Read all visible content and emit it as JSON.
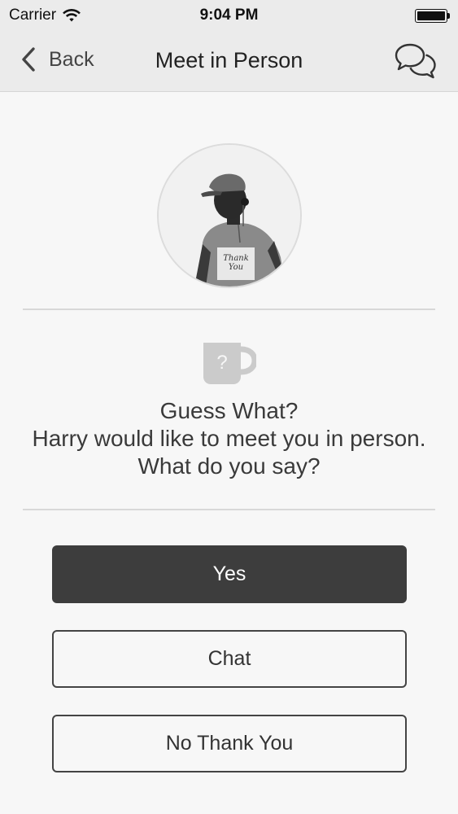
{
  "status_bar": {
    "carrier": "Carrier",
    "time": "9:04 PM",
    "wifi_icon": "wifi-icon",
    "battery_level": 1.0
  },
  "nav": {
    "back_label": "Back",
    "title": "Meet in Person",
    "back_icon": "chevron-left-icon",
    "chat_icon": "chat-bubbles-icon"
  },
  "profile": {
    "avatar_icon": "profile-photo"
  },
  "message": {
    "icon": "mystery-mug-icon",
    "icon_glyph": "?",
    "line1": "Guess What?",
    "line2": "Harry would like to meet you in person.",
    "line3": "What do you say?"
  },
  "actions": {
    "yes_label": "Yes",
    "chat_label": "Chat",
    "decline_label": "No Thank You"
  },
  "colors": {
    "primary_button": "#3d3d3d",
    "background": "#f7f7f7",
    "bar": "#ebebeb",
    "icon_gray": "#cbcbcb"
  }
}
